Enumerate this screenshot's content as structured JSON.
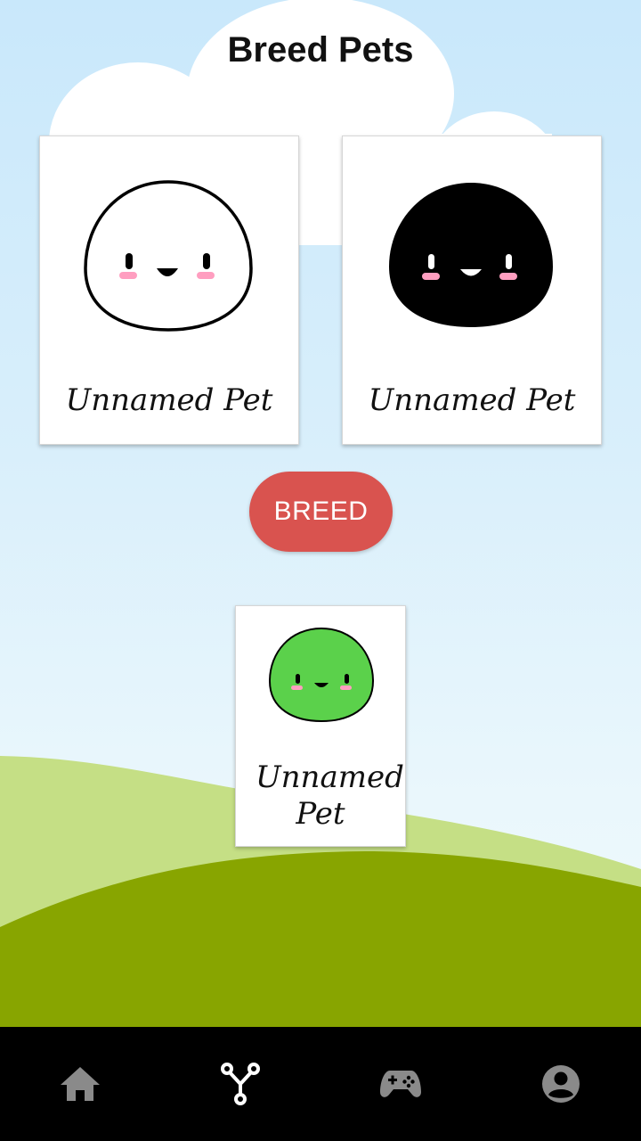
{
  "header": {
    "title": "Breed Pets"
  },
  "parents": [
    {
      "name": "Unnamed Pet",
      "body_color": "#ffffff"
    },
    {
      "name": "Unnamed Pet",
      "body_color": "#000000"
    }
  ],
  "breed_button": {
    "label": "BREED",
    "color": "#d9534f"
  },
  "offspring": {
    "name": "Unnamed Pet",
    "body_color": "#5bd14b"
  },
  "navigation": {
    "items": [
      {
        "icon": "home-icon",
        "active": false
      },
      {
        "icon": "breed-icon",
        "active": true
      },
      {
        "icon": "gamepad-icon",
        "active": false
      },
      {
        "icon": "account-icon",
        "active": false
      }
    ],
    "active_color": "#ffffff",
    "inactive_color": "#8a8a8a"
  },
  "colors": {
    "sky": "#cbe9fb",
    "hill_light": "#c5df85",
    "hill_dark": "#88a500",
    "blush": "#ff9ec0"
  }
}
